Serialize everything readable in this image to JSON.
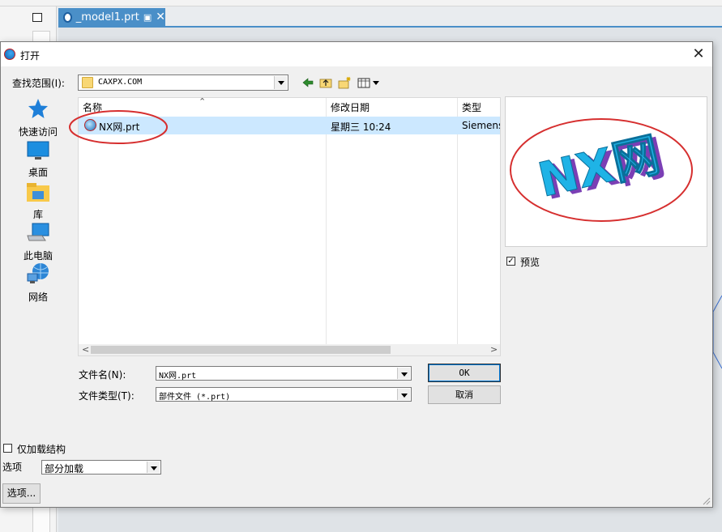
{
  "app": {
    "tab_title": "_model1.prt",
    "tab_close": "✕"
  },
  "dialog": {
    "title": "打开",
    "close_glyph": "✕"
  },
  "lookin": {
    "label": "查找范围(I):",
    "value": "CAXPX.COM"
  },
  "toolbar_icons": [
    "back-icon",
    "up-folder-icon",
    "new-folder-icon",
    "view-menu-icon"
  ],
  "places": [
    {
      "label": "快速访问",
      "icon": "star-icon"
    },
    {
      "label": "桌面",
      "icon": "desktop-icon"
    },
    {
      "label": "库",
      "icon": "library-icon"
    },
    {
      "label": "此电脑",
      "icon": "computer-icon"
    },
    {
      "label": "网络",
      "icon": "network-icon"
    }
  ],
  "filelist": {
    "columns": [
      "名称",
      "修改日期",
      "类型"
    ],
    "rows": [
      {
        "name": "NX网.prt",
        "modified": "星期三 10:24",
        "type": "Siemens",
        "selected": true
      }
    ]
  },
  "preview": {
    "checkbox_label": "预览",
    "checked": true,
    "thumbnail_text": "NX网"
  },
  "filename": {
    "label": "文件名(N):",
    "value": "NX网.prt"
  },
  "filetype": {
    "label": "文件类型(T):",
    "value": "部件文件 (*.prt)"
  },
  "buttons": {
    "ok": "OK",
    "cancel": "取消",
    "options": "选项..."
  },
  "load_structure": {
    "label": "仅加载结构",
    "checked": false
  },
  "options_combo": {
    "label": "选项",
    "value": "部分加载"
  },
  "colors": {
    "selection": "#cce8ff",
    "annotation_red": "#d62f2f",
    "accent_tab": "#4a8fc8"
  }
}
